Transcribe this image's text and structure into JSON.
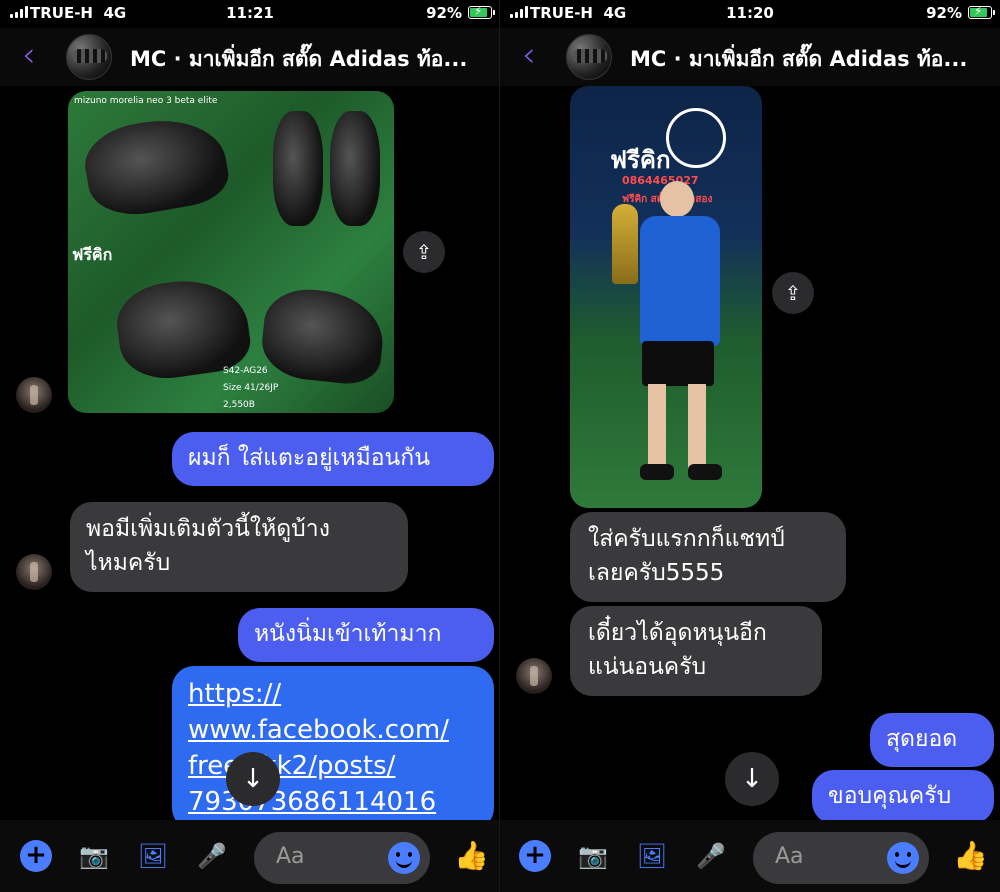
{
  "colors": {
    "accent": "#4a7dff",
    "outgoing": "#4c5ef0",
    "incoming": "#3a3a3c",
    "back": "#8b5cf6",
    "battery": "#34c759"
  },
  "left": {
    "status": {
      "carrier": "TRUE-H",
      "network": "4G",
      "time": "11:21",
      "battery": "92%"
    },
    "header": {
      "back_icon": "chevron-left-icon",
      "title": "MC · มาเพิ่มอีก สตั๊ด Adidas ท้อ..."
    },
    "photo": {
      "caption": "mizuno morelia neo 3 beta elite",
      "brand": "ฟรีคิก",
      "code": "S42-AG26",
      "size": "Size 41/26JP",
      "price": "2,550B"
    },
    "messages": [
      {
        "dir": "out",
        "text": "ผมก็ ใส่แตะอยู่เหมือนกัน"
      },
      {
        "dir": "in",
        "text_line1": "พอมีเพิ่มเติมตัวนี้ให้ดูบ้าง",
        "text_line2": "ไหมครับ"
      },
      {
        "dir": "out",
        "text": "หนังนิ่มเข้าเท้ามาก"
      },
      {
        "dir": "out",
        "link_lines": [
          "https://",
          "www.facebook.com/",
          "freekikk2/posts/",
          "793073686114016"
        ]
      }
    ],
    "composer": {
      "placeholder": "Aa"
    }
  },
  "right": {
    "status": {
      "carrier": "TRUE-H",
      "network": "4G",
      "time": "11:20",
      "battery": "92%"
    },
    "header": {
      "back_icon": "chevron-left-icon",
      "title": "MC · มาเพิ่มอีก สตั๊ด Adidas ท้อ..."
    },
    "photo": {
      "brand": "ฟรีคิก",
      "phone": "0864465027",
      "fb": "ฟรีคิก สตั๊ดแท้มือสอง"
    },
    "messages": [
      {
        "dir": "in",
        "text_line1": "ใส่ครับแรกกก็แชทป์",
        "text_line2": "เลยครับ5555"
      },
      {
        "dir": "in",
        "text_line1": "เดี๋ยวได้อุดหนุนอีก",
        "text_line2": "แน่นอนครับ"
      },
      {
        "dir": "out",
        "text": "สุดยอด"
      },
      {
        "dir": "out",
        "text": "ขอบคุณครับ"
      }
    ],
    "composer": {
      "placeholder": "Aa"
    }
  }
}
